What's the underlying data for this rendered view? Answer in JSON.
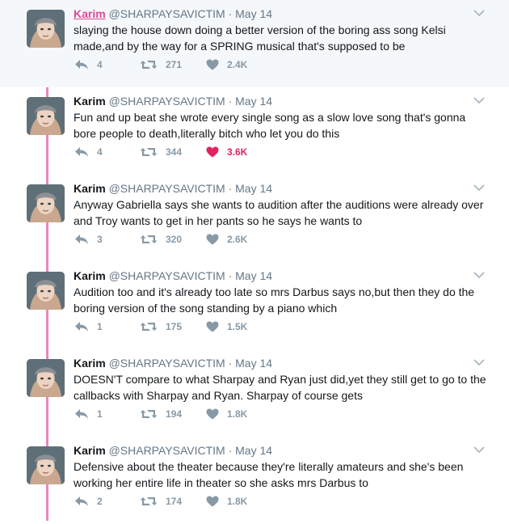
{
  "author": {
    "name": "Karim",
    "handle": "@SHARPAYSAVICTIM"
  },
  "colors": {
    "thread_line": "#e887bf",
    "liked": "#e0245e",
    "action_gray": "#8899a6",
    "name_link": "#e0459a"
  },
  "icons": {
    "reply": "reply-icon",
    "retweet": "retweet-icon",
    "like": "heart-icon",
    "menu": "chevron-down-icon"
  },
  "tweets": [
    {
      "date": "· May 14",
      "text": "slaying the house down doing a better version of the boring ass song Kelsi made,and by the way for a SPRING musical that's supposed to be",
      "replies": "4",
      "retweets": "271",
      "likes": "2.4K",
      "liked": false,
      "highlighted": true
    },
    {
      "date": "· May 14",
      "text": "Fun and up beat she wrote every single song as a slow love song that's gonna bore people to death,literally bitch who let you do this",
      "replies": "4",
      "retweets": "344",
      "likes": "3.6K",
      "liked": true,
      "highlighted": false
    },
    {
      "date": "· May 14",
      "text": "Anyway Gabriella  says she wants to audition after the auditions were already over and Troy wants to get in her pants so he says he wants to",
      "replies": "3",
      "retweets": "320",
      "likes": "2.6K",
      "liked": false,
      "highlighted": false
    },
    {
      "date": "· May 14",
      "text": "Audition too and it's already too late so mrs Darbus says no,but then they do the boring version of the song standing by a piano which",
      "replies": "1",
      "retweets": "175",
      "likes": "1.5K",
      "liked": false,
      "highlighted": false
    },
    {
      "date": "· May 14",
      "text": "DOESN'T compare to what Sharpay and Ryan just did,yet they still get to go to the callbacks with Sharpay and Ryan. Sharpay of course gets",
      "replies": "1",
      "retweets": "194",
      "likes": "1.8K",
      "liked": false,
      "highlighted": false
    },
    {
      "date": "· May 14",
      "text": "Defensive about the theater because they're literally amateurs and she's been working her entire life in theater so she asks mrs Darbus to",
      "replies": "2",
      "retweets": "174",
      "likes": "1.8K",
      "liked": false,
      "highlighted": false
    }
  ]
}
